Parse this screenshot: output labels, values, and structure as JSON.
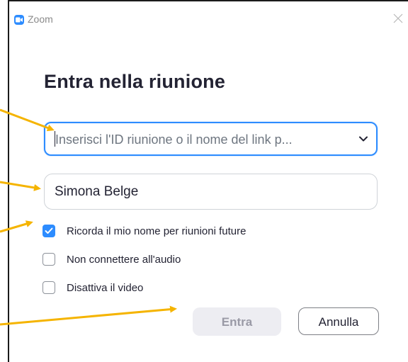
{
  "window": {
    "title": "Zoom",
    "icon": "zoom-logo-icon",
    "close_icon": "close-icon"
  },
  "dialog": {
    "heading": "Entra nella riunione",
    "meeting_id": {
      "value": "",
      "placeholder": "Inserisci l'ID riunione o il nome del link p...",
      "dropdown_icon": "chevron-down-icon"
    },
    "name": {
      "value": "Simona Belge"
    },
    "options": [
      {
        "label": "Ricorda il mio nome per riunioni future",
        "checked": true
      },
      {
        "label": "Non connettere all'audio",
        "checked": false
      },
      {
        "label": "Disattiva il video",
        "checked": false
      }
    ],
    "buttons": {
      "join_label": "Entra",
      "cancel_label": "Annulla"
    }
  },
  "colors": {
    "accent": "#2d8cff",
    "annotation_arrow": "#f5b400",
    "text": "#232333",
    "disabled_button_bg": "#ededf2"
  }
}
